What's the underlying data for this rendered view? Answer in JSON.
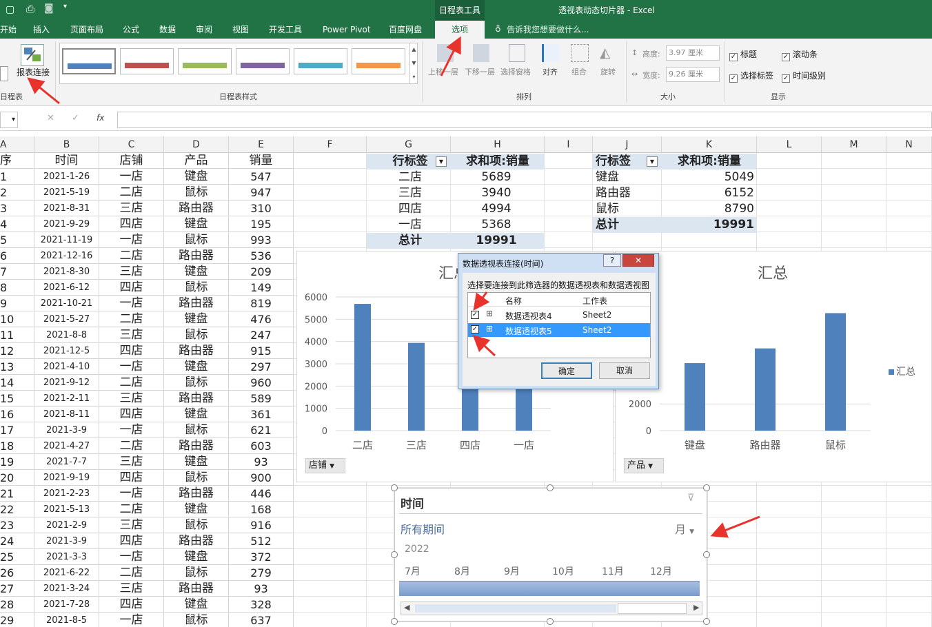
{
  "window": {
    "title": "透视表动态切片器 - Excel",
    "context_tab": "日程表工具"
  },
  "tabs": [
    "开始",
    "插入",
    "页面布局",
    "公式",
    "数据",
    "审阅",
    "视图",
    "开发工具",
    "Power Pivot",
    "百度网盘",
    "选项"
  ],
  "tell_me": "告诉我您想要做什么...",
  "ribbon": {
    "report_conn": "报表连接",
    "group_left": "日程表",
    "group_styles": "日程表样式",
    "bring_forward": "上移一层",
    "send_backward": "下移一层",
    "selection_pane": "选择窗格",
    "align": "对齐",
    "group": "组合",
    "rotate": "旋转",
    "group_arrange": "排列",
    "height_label": "高度:",
    "height_value": "3.97 厘米",
    "width_label": "宽度:",
    "width_value": "9.26 厘米",
    "group_size": "大小",
    "cb_title": "标题",
    "cb_scrollbar": "滚动条",
    "cb_sel_label": "选择标签",
    "cb_time_level": "时间级别",
    "group_show": "显示"
  },
  "columns": [
    "A",
    "B",
    "C",
    "D",
    "E",
    "F",
    "G",
    "H",
    "I",
    "J",
    "K",
    "L",
    "M",
    "N"
  ],
  "table": {
    "headers": [
      "序",
      "时间",
      "店铺",
      "产品",
      "销量"
    ],
    "rows": [
      [
        "1",
        "2021-1-26",
        "一店",
        "键盘",
        "547"
      ],
      [
        "2",
        "2021-5-19",
        "二店",
        "鼠标",
        "947"
      ],
      [
        "3",
        "2021-8-31",
        "三店",
        "路由器",
        "310"
      ],
      [
        "4",
        "2021-9-29",
        "四店",
        "键盘",
        "195"
      ],
      [
        "5",
        "2021-11-19",
        "一店",
        "鼠标",
        "993"
      ],
      [
        "6",
        "2021-12-16",
        "二店",
        "路由器",
        "536"
      ],
      [
        "7",
        "2021-8-30",
        "三店",
        "键盘",
        "209"
      ],
      [
        "8",
        "2021-6-12",
        "四店",
        "鼠标",
        "149"
      ],
      [
        "9",
        "2021-10-21",
        "一店",
        "路由器",
        "819"
      ],
      [
        "10",
        "2021-5-27",
        "二店",
        "键盘",
        "476"
      ],
      [
        "11",
        "2021-8-8",
        "三店",
        "鼠标",
        "247"
      ],
      [
        "12",
        "2021-12-5",
        "四店",
        "路由器",
        "915"
      ],
      [
        "13",
        "2021-4-10",
        "一店",
        "键盘",
        "297"
      ],
      [
        "14",
        "2021-9-12",
        "二店",
        "鼠标",
        "960"
      ],
      [
        "15",
        "2021-2-11",
        "三店",
        "路由器",
        "589"
      ],
      [
        "16",
        "2021-8-11",
        "四店",
        "键盘",
        "361"
      ],
      [
        "17",
        "2021-3-9",
        "一店",
        "鼠标",
        "621"
      ],
      [
        "18",
        "2021-4-27",
        "二店",
        "路由器",
        "603"
      ],
      [
        "19",
        "2021-7-7",
        "三店",
        "键盘",
        "93"
      ],
      [
        "20",
        "2021-9-19",
        "四店",
        "鼠标",
        "900"
      ],
      [
        "21",
        "2021-2-23",
        "一店",
        "路由器",
        "446"
      ],
      [
        "22",
        "2021-5-13",
        "二店",
        "键盘",
        "168"
      ],
      [
        "23",
        "2021-2-9",
        "三店",
        "鼠标",
        "916"
      ],
      [
        "24",
        "2021-3-9",
        "四店",
        "路由器",
        "512"
      ],
      [
        "25",
        "2021-3-3",
        "一店",
        "键盘",
        "372"
      ],
      [
        "26",
        "2021-6-22",
        "二店",
        "鼠标",
        "279"
      ],
      [
        "27",
        "2021-3-24",
        "三店",
        "路由器",
        "93"
      ],
      [
        "28",
        "2021-7-28",
        "四店",
        "键盘",
        "328"
      ],
      [
        "29",
        "2021-8-5",
        "一店",
        "鼠标",
        "637"
      ]
    ]
  },
  "pivot1": {
    "row_label": "行标签",
    "value_label": "求和项:销量",
    "rows": [
      [
        "二店",
        "5689"
      ],
      [
        "三店",
        "3940"
      ],
      [
        "四店",
        "4994"
      ],
      [
        "一店",
        "5368"
      ]
    ],
    "total_label": "总计",
    "total": "19991"
  },
  "pivot2": {
    "row_label": "行标签",
    "value_label": "求和项:销量",
    "rows": [
      [
        "键盘",
        "5049"
      ],
      [
        "路由器",
        "6152"
      ],
      [
        "鼠标",
        "8790"
      ]
    ],
    "total_label": "总计",
    "total": "19991"
  },
  "chart_data": [
    {
      "type": "bar",
      "title": "汇总",
      "categories": [
        "二店",
        "三店",
        "四店",
        "一店"
      ],
      "values": [
        5689,
        3940,
        4994,
        5368
      ],
      "ylim": [
        0,
        6000
      ],
      "yticks": [
        "0",
        "1000",
        "2000",
        "3000",
        "4000",
        "5000",
        "6000"
      ],
      "field_button": "店铺",
      "color": "#4f81bd"
    },
    {
      "type": "bar",
      "title": "汇总",
      "categories": [
        "键盘",
        "路由器",
        "鼠标"
      ],
      "values": [
        5049,
        6152,
        8790
      ],
      "ylim": [
        0,
        10000
      ],
      "yticks": [
        "0",
        "2000"
      ],
      "field_button": "产品",
      "legend": "汇总",
      "legend_position": "right",
      "color": "#4f81bd"
    }
  ],
  "dialog": {
    "title": "数据透视表连接(时间)",
    "help": "?",
    "close": "✕",
    "prompt": "选择要连接到此筛选器的数据透视表和数据透视图",
    "col_name": "名称",
    "col_sheet": "工作表",
    "items": [
      {
        "name": "数据透视表4",
        "sheet": "Sheet2",
        "checked": "✓"
      },
      {
        "name": "数据透视表5",
        "sheet": "Sheet2",
        "checked": "✓"
      }
    ],
    "ok": "确定",
    "cancel": "取消"
  },
  "timeline": {
    "title": "时间",
    "period": "所有期间",
    "level": "月",
    "year": "2022",
    "months": [
      "7月",
      "8月",
      "9月",
      "10月",
      "11月",
      "12月"
    ]
  }
}
